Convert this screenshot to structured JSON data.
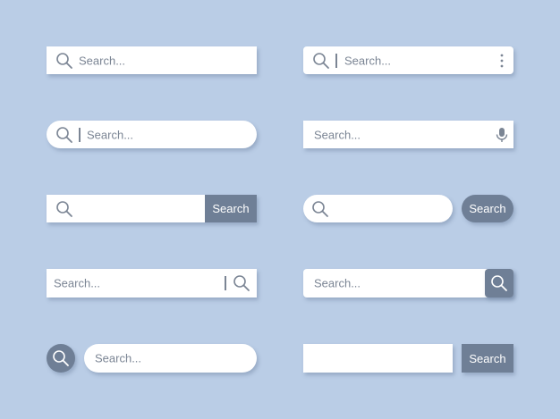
{
  "colors": {
    "background": "#bacde6",
    "field": "#ffffff",
    "button": "#6f7f96",
    "icon": "#7b8594"
  },
  "placeholder": "Search...",
  "button_label": "Search",
  "icons": {
    "search": "magnifier-glyph",
    "more": "vertical-ellipsis",
    "mic": "microphone"
  }
}
